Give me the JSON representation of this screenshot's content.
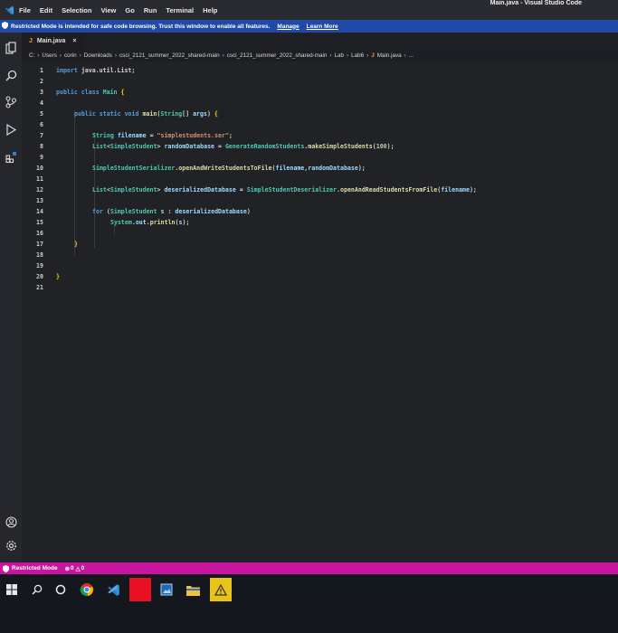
{
  "window": {
    "title": "Main.java - Visual Studio Code"
  },
  "menu": [
    "File",
    "Edit",
    "Selection",
    "View",
    "Go",
    "Run",
    "Terminal",
    "Help"
  ],
  "notice": {
    "text": "Restricted Mode is intended for safe code browsing. Trust this window to enable all features.",
    "manage": "Manage",
    "learn_more": "Learn More"
  },
  "tab": {
    "icon_letter": "J",
    "label": "Main.java",
    "close": "×"
  },
  "breadcrumb": [
    "C:",
    "Users",
    "corin",
    "Downloads",
    "csci_2121_summer_2022_shared-main",
    "csci_2121_summer_2022_shared-main",
    "Lab",
    "Lab6",
    "Main.java",
    "..."
  ],
  "activity_icons": [
    "explorer-icon",
    "search-icon",
    "source-control-icon",
    "run-debug-icon",
    "extensions-icon",
    "accounts-icon",
    "manage-gear-icon"
  ],
  "code": {
    "line_numbers": [
      "1",
      "2",
      "3",
      "4",
      "5",
      "6",
      "7",
      "8",
      "9",
      "10",
      "11",
      "12",
      "13",
      "14",
      "15",
      "16",
      "17",
      "18",
      "19",
      "20",
      "21"
    ]
  },
  "statusbar": {
    "mode": "Restricted Mode",
    "errors": "0",
    "warnings": "0"
  },
  "taskbar_icons": [
    "windows-start-icon",
    "search-icon",
    "cortana-icon",
    "chrome-icon",
    "vscode-icon",
    "red-app-icon",
    "photos-icon",
    "file-explorer-icon",
    "warning-app-icon"
  ],
  "colors": {
    "statusbar": "#c8159f",
    "notice": "#1f4aa8",
    "editor_bg": "#212226"
  }
}
